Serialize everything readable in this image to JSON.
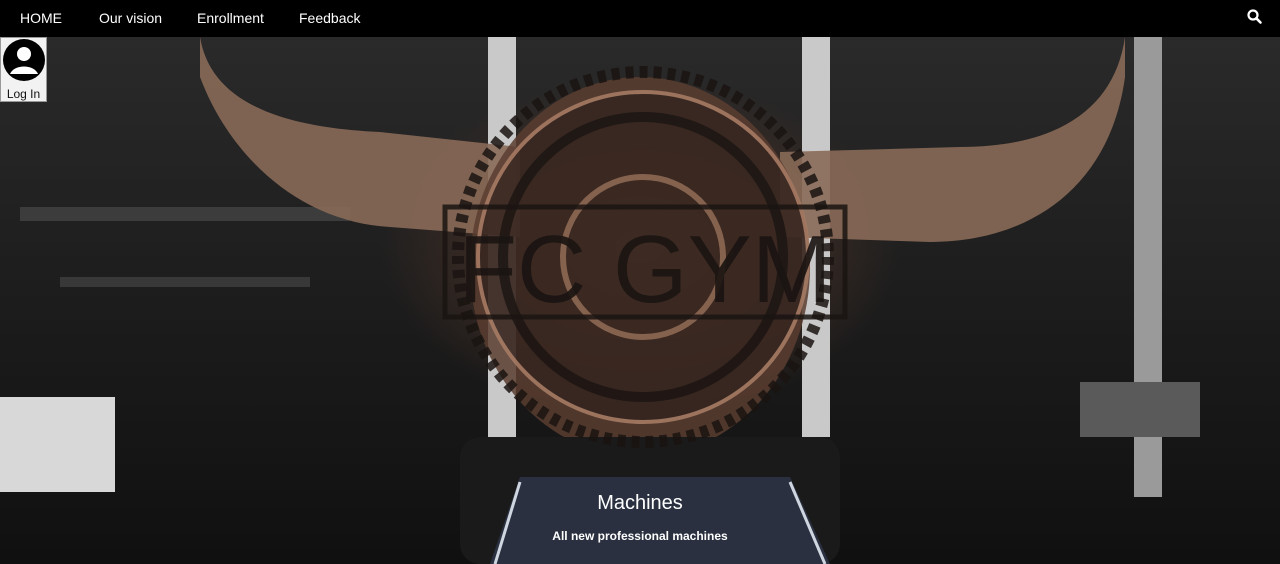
{
  "nav": {
    "items": [
      "HOME",
      "Our vision",
      "Enrollment",
      "Feedback"
    ]
  },
  "icons": {
    "search": "search-icon",
    "user": "user-avatar-icon"
  },
  "login": {
    "label": "Log In"
  },
  "hero": {
    "logo_text": "FC GYM",
    "caption_title": "Machines",
    "caption_subtitle": "All new professional machines"
  }
}
